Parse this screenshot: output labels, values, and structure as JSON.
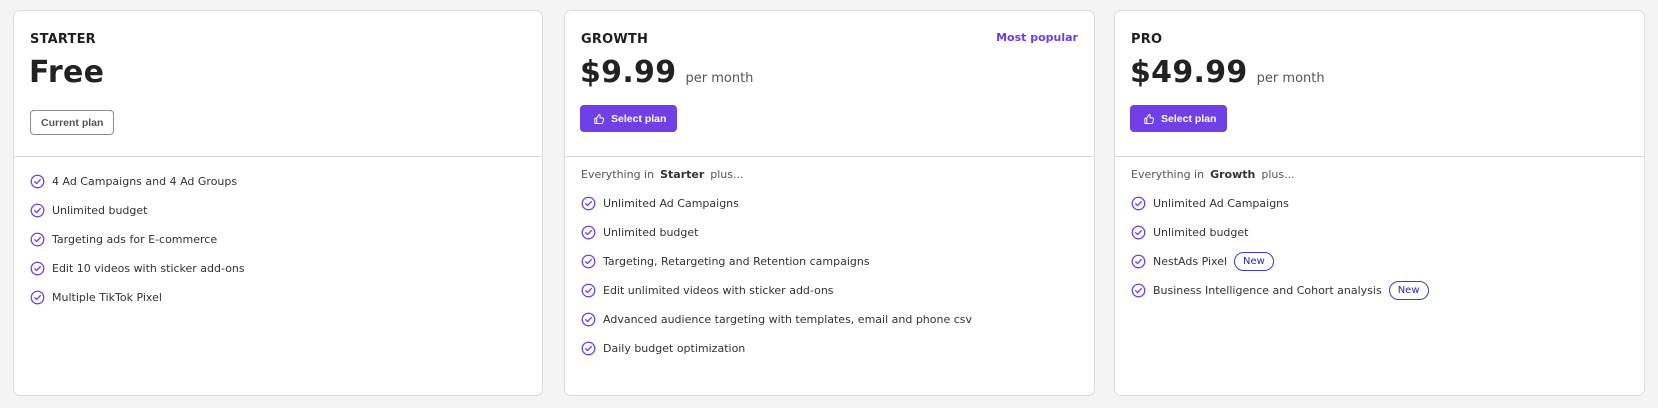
{
  "plans": {
    "starter": {
      "name": "STARTER",
      "price": "Free",
      "button": "Current plan",
      "features": [
        "4 Ad Campaigns and 4 Ad Groups",
        "Unlimited budget",
        "Targeting ads for E-commerce",
        "Edit 10 videos with sticker add-ons",
        "Multiple TikTok Pixel"
      ]
    },
    "growth": {
      "name": "GROWTH",
      "badge": "Most popular",
      "price": "$9.99",
      "period": "per month",
      "button": "Select plan",
      "intro_prefix": "Everything in",
      "intro_plan": "Starter",
      "intro_suffix": "plus...",
      "features": [
        "Unlimited Ad Campaigns",
        "Unlimited budget",
        "Targeting, Retargeting and Retention campaigns",
        "Edit unlimited videos with sticker add-ons",
        "Advanced audience targeting with templates, email and phone csv",
        "Daily budget optimization"
      ]
    },
    "pro": {
      "name": "PRO",
      "price": "$49.99",
      "period": "per month",
      "button": "Select plan",
      "intro_prefix": "Everything in",
      "intro_plan": "Growth",
      "intro_suffix": "plus...",
      "features": [
        "Unlimited Ad Campaigns",
        "Unlimited budget",
        "NestAds Pixel",
        "Business Intelligence and Cohort analysis"
      ],
      "new_tag": "New"
    }
  },
  "colors": {
    "accent": "#6e40e6",
    "new_tag_border": "#3b3bd0"
  },
  "icons": {
    "check": "check-circle-icon",
    "select": "thumbs-up-icon"
  }
}
